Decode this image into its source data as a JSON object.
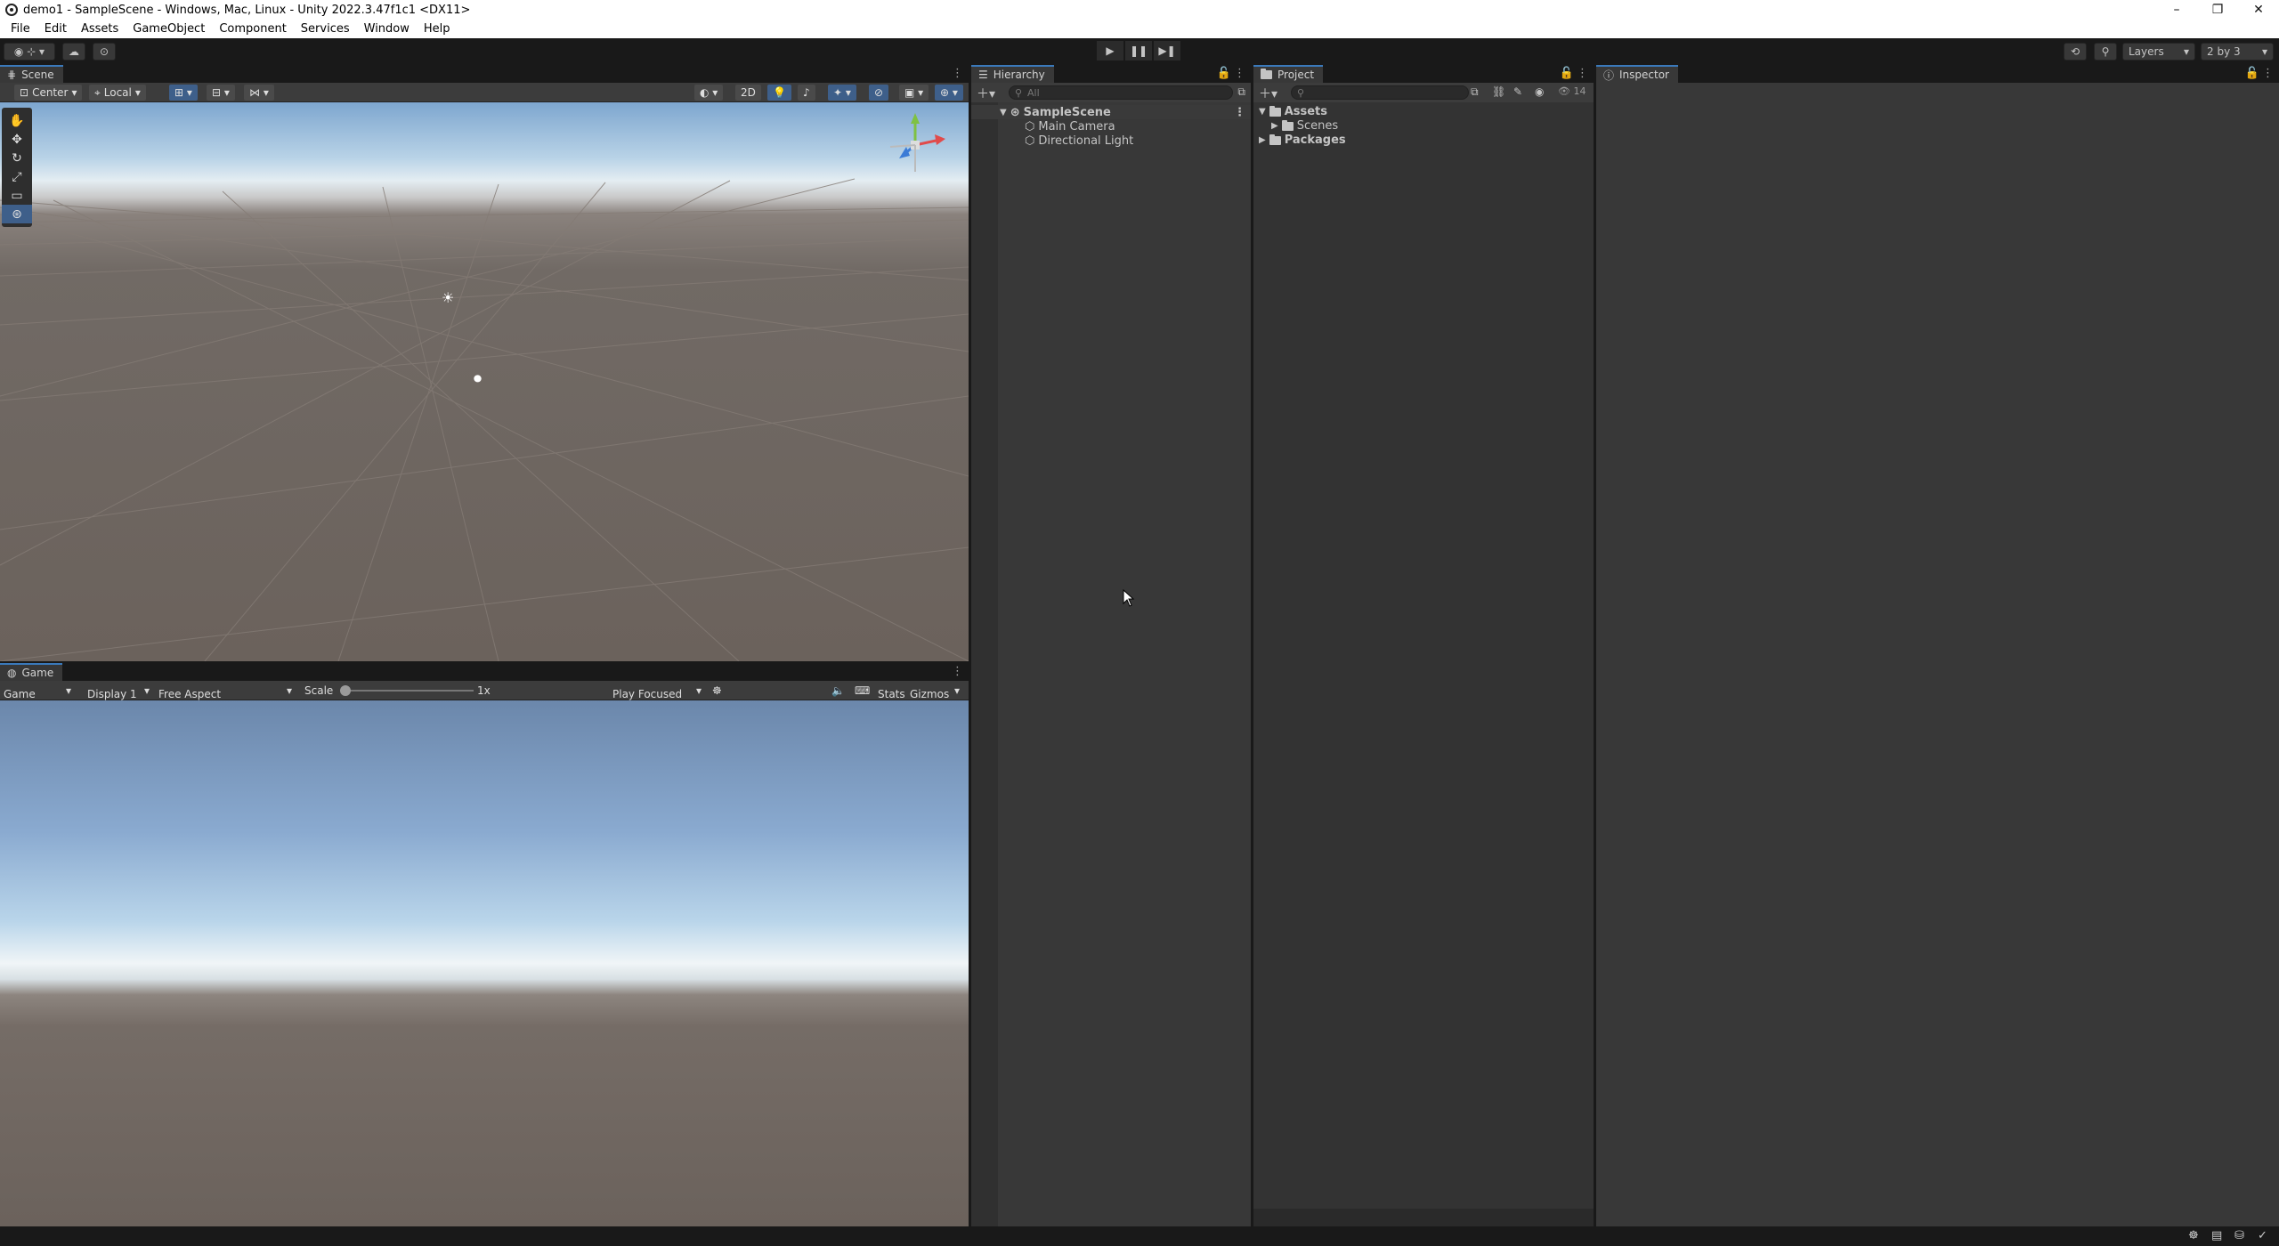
{
  "window": {
    "title": "demo1 - SampleScene - Windows, Mac, Linux - Unity 2022.3.47f1c1 <DX11>",
    "controls": {
      "minimize": "–",
      "restore": "❐",
      "close": "✕"
    }
  },
  "menu": [
    "File",
    "Edit",
    "Assets",
    "GameObject",
    "Component",
    "Services",
    "Window",
    "Help"
  ],
  "toolbar": {
    "layers_label": "Layers",
    "layout_label": "2 by 3"
  },
  "scene_panel": {
    "tab_label": "Scene",
    "pivot_label": "Center",
    "space_label": "Local",
    "mode_2d_label": "2D"
  },
  "game_panel": {
    "tab_label": "Game",
    "mode_label": "Game",
    "display_label": "Display 1",
    "aspect_label": "Free Aspect",
    "scale_label": "Scale",
    "scale_value": "1x",
    "play_focus_label": "Play Focused",
    "stats_label": "Stats",
    "gizmos_label": "Gizmos"
  },
  "hierarchy": {
    "tab_label": "Hierarchy",
    "search_placeholder": "All",
    "scene_name": "SampleScene",
    "items": [
      "Main Camera",
      "Directional Light"
    ]
  },
  "project": {
    "tab_label": "Project",
    "hidden_count": "14",
    "tree": [
      {
        "label": "Assets",
        "children": [
          "Scenes"
        ]
      },
      {
        "label": "Packages",
        "children": []
      }
    ]
  },
  "inspector": {
    "tab_label": "Inspector"
  },
  "colors": {
    "accent": "#3a79bb",
    "panel_bg": "#383838",
    "chrome_bg": "#191919"
  }
}
